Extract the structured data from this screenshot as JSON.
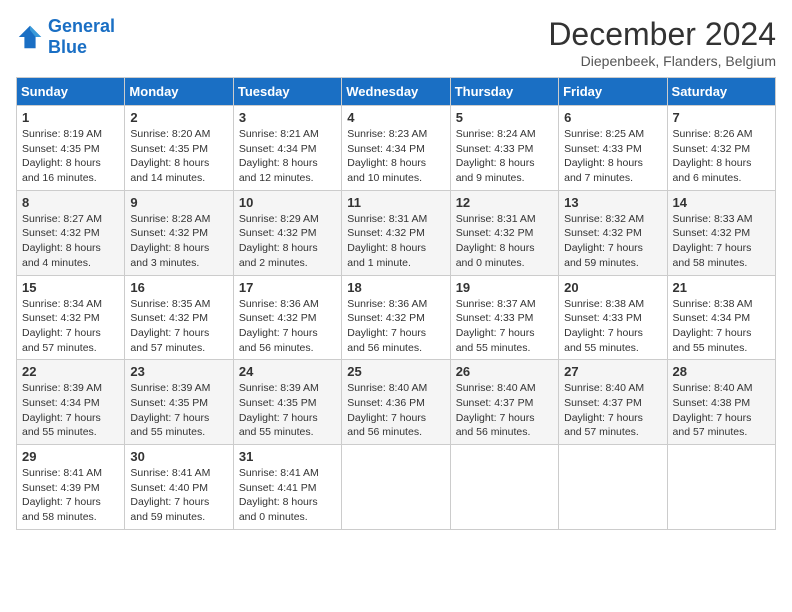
{
  "header": {
    "logo_line1": "General",
    "logo_line2": "Blue",
    "main_title": "December 2024",
    "subtitle": "Diepenbeek, Flanders, Belgium"
  },
  "weekdays": [
    "Sunday",
    "Monday",
    "Tuesday",
    "Wednesday",
    "Thursday",
    "Friday",
    "Saturday"
  ],
  "weeks": [
    [
      {
        "day": "1",
        "info": "Sunrise: 8:19 AM\nSunset: 4:35 PM\nDaylight: 8 hours\nand 16 minutes."
      },
      {
        "day": "2",
        "info": "Sunrise: 8:20 AM\nSunset: 4:35 PM\nDaylight: 8 hours\nand 14 minutes."
      },
      {
        "day": "3",
        "info": "Sunrise: 8:21 AM\nSunset: 4:34 PM\nDaylight: 8 hours\nand 12 minutes."
      },
      {
        "day": "4",
        "info": "Sunrise: 8:23 AM\nSunset: 4:34 PM\nDaylight: 8 hours\nand 10 minutes."
      },
      {
        "day": "5",
        "info": "Sunrise: 8:24 AM\nSunset: 4:33 PM\nDaylight: 8 hours\nand 9 minutes."
      },
      {
        "day": "6",
        "info": "Sunrise: 8:25 AM\nSunset: 4:33 PM\nDaylight: 8 hours\nand 7 minutes."
      },
      {
        "day": "7",
        "info": "Sunrise: 8:26 AM\nSunset: 4:32 PM\nDaylight: 8 hours\nand 6 minutes."
      }
    ],
    [
      {
        "day": "8",
        "info": "Sunrise: 8:27 AM\nSunset: 4:32 PM\nDaylight: 8 hours\nand 4 minutes."
      },
      {
        "day": "9",
        "info": "Sunrise: 8:28 AM\nSunset: 4:32 PM\nDaylight: 8 hours\nand 3 minutes."
      },
      {
        "day": "10",
        "info": "Sunrise: 8:29 AM\nSunset: 4:32 PM\nDaylight: 8 hours\nand 2 minutes."
      },
      {
        "day": "11",
        "info": "Sunrise: 8:31 AM\nSunset: 4:32 PM\nDaylight: 8 hours\nand 1 minute."
      },
      {
        "day": "12",
        "info": "Sunrise: 8:31 AM\nSunset: 4:32 PM\nDaylight: 8 hours\nand 0 minutes."
      },
      {
        "day": "13",
        "info": "Sunrise: 8:32 AM\nSunset: 4:32 PM\nDaylight: 7 hours\nand 59 minutes."
      },
      {
        "day": "14",
        "info": "Sunrise: 8:33 AM\nSunset: 4:32 PM\nDaylight: 7 hours\nand 58 minutes."
      }
    ],
    [
      {
        "day": "15",
        "info": "Sunrise: 8:34 AM\nSunset: 4:32 PM\nDaylight: 7 hours\nand 57 minutes."
      },
      {
        "day": "16",
        "info": "Sunrise: 8:35 AM\nSunset: 4:32 PM\nDaylight: 7 hours\nand 57 minutes."
      },
      {
        "day": "17",
        "info": "Sunrise: 8:36 AM\nSunset: 4:32 PM\nDaylight: 7 hours\nand 56 minutes."
      },
      {
        "day": "18",
        "info": "Sunrise: 8:36 AM\nSunset: 4:32 PM\nDaylight: 7 hours\nand 56 minutes."
      },
      {
        "day": "19",
        "info": "Sunrise: 8:37 AM\nSunset: 4:33 PM\nDaylight: 7 hours\nand 55 minutes."
      },
      {
        "day": "20",
        "info": "Sunrise: 8:38 AM\nSunset: 4:33 PM\nDaylight: 7 hours\nand 55 minutes."
      },
      {
        "day": "21",
        "info": "Sunrise: 8:38 AM\nSunset: 4:34 PM\nDaylight: 7 hours\nand 55 minutes."
      }
    ],
    [
      {
        "day": "22",
        "info": "Sunrise: 8:39 AM\nSunset: 4:34 PM\nDaylight: 7 hours\nand 55 minutes."
      },
      {
        "day": "23",
        "info": "Sunrise: 8:39 AM\nSunset: 4:35 PM\nDaylight: 7 hours\nand 55 minutes."
      },
      {
        "day": "24",
        "info": "Sunrise: 8:39 AM\nSunset: 4:35 PM\nDaylight: 7 hours\nand 55 minutes."
      },
      {
        "day": "25",
        "info": "Sunrise: 8:40 AM\nSunset: 4:36 PM\nDaylight: 7 hours\nand 56 minutes."
      },
      {
        "day": "26",
        "info": "Sunrise: 8:40 AM\nSunset: 4:37 PM\nDaylight: 7 hours\nand 56 minutes."
      },
      {
        "day": "27",
        "info": "Sunrise: 8:40 AM\nSunset: 4:37 PM\nDaylight: 7 hours\nand 57 minutes."
      },
      {
        "day": "28",
        "info": "Sunrise: 8:40 AM\nSunset: 4:38 PM\nDaylight: 7 hours\nand 57 minutes."
      }
    ],
    [
      {
        "day": "29",
        "info": "Sunrise: 8:41 AM\nSunset: 4:39 PM\nDaylight: 7 hours\nand 58 minutes."
      },
      {
        "day": "30",
        "info": "Sunrise: 8:41 AM\nSunset: 4:40 PM\nDaylight: 7 hours\nand 59 minutes."
      },
      {
        "day": "31",
        "info": "Sunrise: 8:41 AM\nSunset: 4:41 PM\nDaylight: 8 hours\nand 0 minutes."
      },
      {
        "day": "",
        "info": ""
      },
      {
        "day": "",
        "info": ""
      },
      {
        "day": "",
        "info": ""
      },
      {
        "day": "",
        "info": ""
      }
    ]
  ]
}
